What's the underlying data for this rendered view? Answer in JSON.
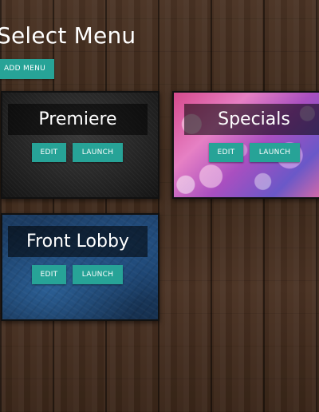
{
  "page": {
    "title": "Select Menu",
    "add_button_label": "ADD MENU"
  },
  "menus": [
    {
      "name": "Premiere",
      "edit_label": "EDIT",
      "launch_label": "LAUNCH"
    },
    {
      "name": "Specials",
      "edit_label": "EDIT",
      "launch_label": "LAUNCH"
    },
    {
      "name": "Front Lobby",
      "edit_label": "EDIT",
      "launch_label": "LAUNCH"
    }
  ],
  "colors": {
    "accent": "#27a397",
    "title_text": "#ffffff"
  }
}
